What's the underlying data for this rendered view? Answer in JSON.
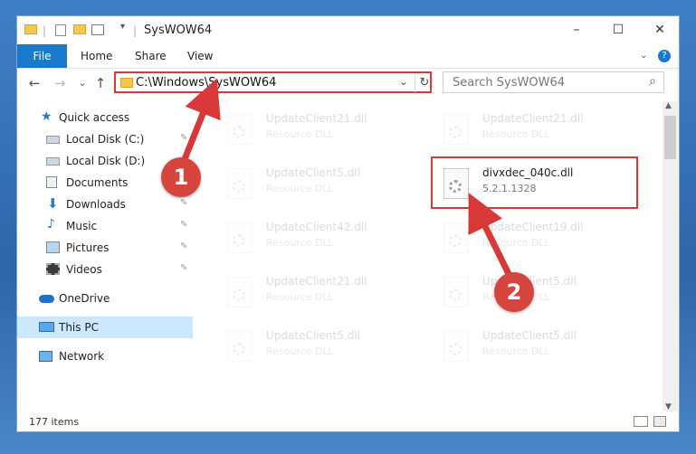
{
  "window": {
    "title": "SysWOW64",
    "controls": {
      "minimize": "–",
      "maximize": "☐",
      "close": "✕"
    }
  },
  "ribbon": {
    "file_tab": "File",
    "tabs": [
      "Home",
      "Share",
      "View"
    ],
    "help_icon": "?"
  },
  "navigation": {
    "back_icon": "←",
    "forward_icon": "→",
    "recent_icon": "⌄",
    "up_icon": "↑",
    "address": "C:\\Windows\\SysWOW64",
    "refresh_icon": "↻",
    "search_placeholder": "Search SysWOW64",
    "search_icon": "⌕"
  },
  "sidebar": {
    "items": [
      {
        "label": "Quick access",
        "icon": "star-icon",
        "pinned": false
      },
      {
        "label": "Local Disk (C:)",
        "icon": "drive-icon",
        "pinned": true
      },
      {
        "label": "Local Disk (D:)",
        "icon": "drive-icon",
        "pinned": false
      },
      {
        "label": "Documents",
        "icon": "documents-icon",
        "pinned": true
      },
      {
        "label": "Downloads",
        "icon": "download-icon",
        "pinned": true
      },
      {
        "label": "Music",
        "icon": "music-icon",
        "pinned": true
      },
      {
        "label": "Pictures",
        "icon": "pictures-icon",
        "pinned": true
      },
      {
        "label": "Videos",
        "icon": "videos-icon",
        "pinned": true
      },
      {
        "label": "OneDrive",
        "icon": "cloud-icon",
        "pinned": false
      },
      {
        "label": "This PC",
        "icon": "computer-icon",
        "pinned": false,
        "selected": true
      },
      {
        "label": "Network",
        "icon": "network-icon",
        "pinned": false
      }
    ],
    "pin_glyph": "📌"
  },
  "files": [
    {
      "name": "UpdateClient21.dll",
      "type": "Resource DLL",
      "faded": true
    },
    {
      "name": "UpdateClient21.dll",
      "type": "Resource DLL",
      "faded": true
    },
    {
      "name": "UpdateClient5.dll",
      "type": "Resource DLL",
      "faded": true
    },
    {
      "name": "divxdec_040c.dll",
      "type": "5.2.1.1328",
      "faded": false
    },
    {
      "name": "UpdateClient42.dll",
      "type": "Resource DLL",
      "faded": true
    },
    {
      "name": "UpdateClient19.dll",
      "type": "Resource DLL",
      "faded": true
    },
    {
      "name": "UpdateClient21.dll",
      "type": "Resource DLL",
      "faded": true
    },
    {
      "name": "UpdateClient5.dll",
      "type": "Resource DLL",
      "faded": true
    },
    {
      "name": "UpdateClient5.dll",
      "type": "Resource DLL",
      "faded": true
    },
    {
      "name": "UpdateClient5.dll",
      "type": "Resource DLL",
      "faded": true
    }
  ],
  "status": {
    "item_count": "177 items"
  },
  "annotations": {
    "step1": "1",
    "step2": "2",
    "color": "#d93838"
  }
}
